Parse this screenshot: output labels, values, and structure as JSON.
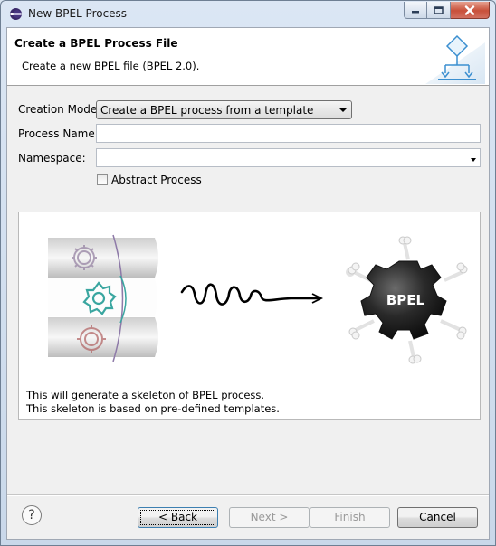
{
  "window": {
    "title": "New BPEL Process",
    "controls": {
      "minimize_icon": "minimize-icon",
      "maximize_icon": "maximize-icon",
      "close_icon": "close-icon"
    }
  },
  "banner": {
    "title": "Create a BPEL Process File",
    "description": "Create a new BPEL file (BPEL 2.0).",
    "icon": "bpel-process-wizard-icon"
  },
  "form": {
    "creation_mode": {
      "label": "Creation Mode:",
      "value": "Create a BPEL process from a template"
    },
    "process_name": {
      "label": "Process Name:",
      "value": ""
    },
    "namespace": {
      "label": "Namespace:",
      "value": ""
    },
    "abstract_process": {
      "label": "Abstract Process",
      "checked": false
    }
  },
  "preview": {
    "graphic_label": "BPEL",
    "lines": [
      "This will generate a skeleton of BPEL process.",
      "This skeleton is based on pre-defined templates."
    ]
  },
  "buttons": {
    "help_icon": "help-icon",
    "back": "< Back",
    "next": "Next >",
    "finish": "Finish",
    "cancel": "Cancel"
  },
  "colors": {
    "accent": "#3c7fb1",
    "teal_gear": "#3aa6a0",
    "red_gear": "#b06060"
  }
}
